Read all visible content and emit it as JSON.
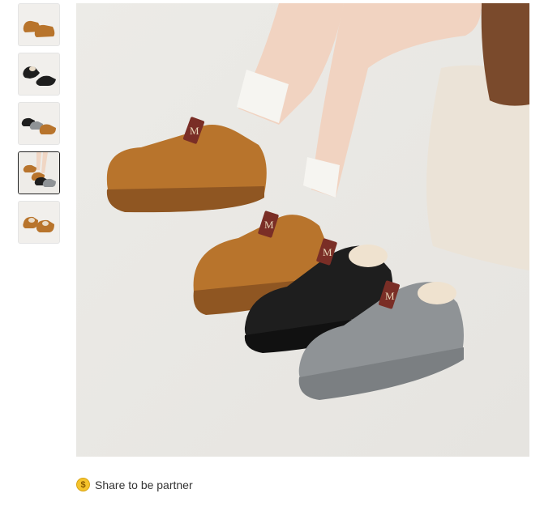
{
  "gallery": {
    "thumbnails": [
      {
        "alt": "brown-pair"
      },
      {
        "alt": "black-pair"
      },
      {
        "alt": "three-colors"
      },
      {
        "alt": "model-wearing"
      },
      {
        "alt": "brown-pair-top"
      }
    ],
    "active_index": 3
  },
  "main_image": {
    "logo_letter": "M"
  },
  "share": {
    "label": "Share to be partner",
    "icon": "coin-icon",
    "icon_glyph": "$"
  },
  "colors": {
    "brown": "#b8742c",
    "black": "#1e1e1e",
    "gray": "#8f9396",
    "badge": "#7a2e26",
    "coin": "#f5c32c"
  }
}
